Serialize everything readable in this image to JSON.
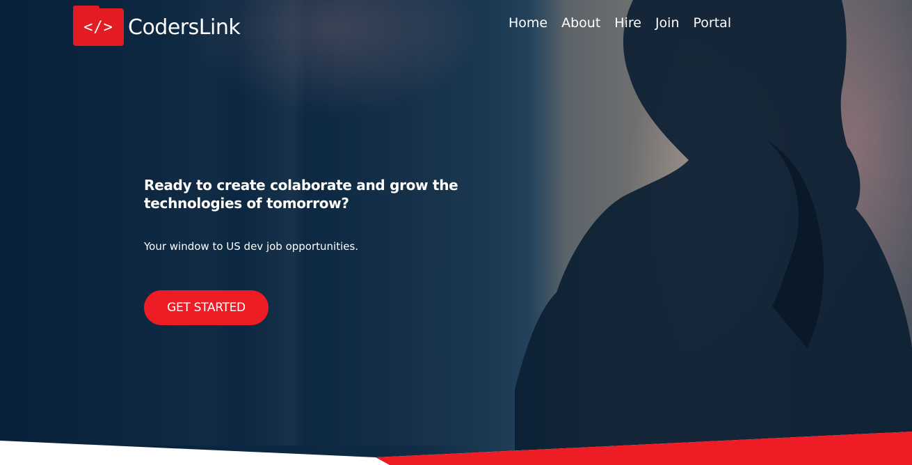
{
  "brand": {
    "logo_glyph": "</>",
    "name": "CodersLink",
    "color": "#e31b23"
  },
  "nav": {
    "items": [
      {
        "label": "Home"
      },
      {
        "label": "About"
      },
      {
        "label": "Hire"
      },
      {
        "label": "Join"
      },
      {
        "label": "Portal"
      }
    ]
  },
  "hero": {
    "headline": "Ready to create colaborate and grow the technologies of tomorrow?",
    "subline": "Your window to US dev job opportunities.",
    "cta_label": "GET STARTED",
    "cta_color": "#ee1c25"
  },
  "decor": {
    "bottom_band_color": "#ee1c25"
  }
}
